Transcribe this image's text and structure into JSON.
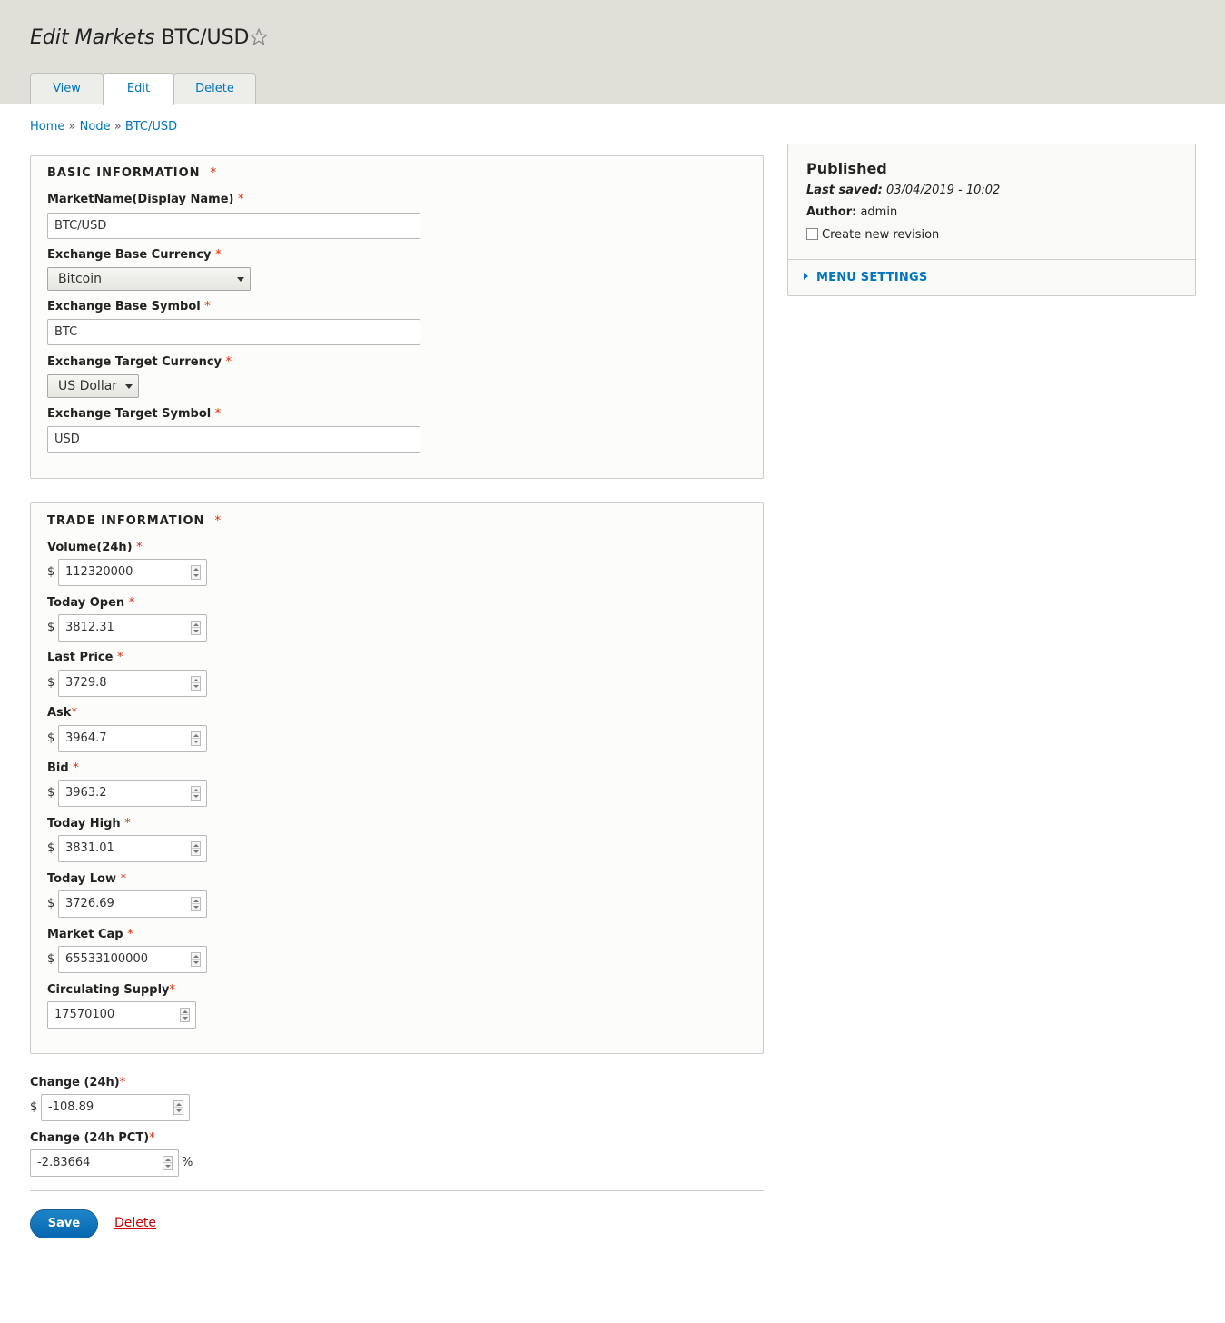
{
  "header": {
    "title_prefix": "Edit Markets",
    "title_name": "BTC/USD",
    "tabs": [
      {
        "label": "View",
        "active": false
      },
      {
        "label": "Edit",
        "active": true
      },
      {
        "label": "Delete",
        "active": false
      }
    ]
  },
  "breadcrumb": {
    "items": [
      "Home",
      "Node",
      "BTC/USD"
    ],
    "separator": "»"
  },
  "basic": {
    "legend": "BASIC INFORMATION",
    "market_name": {
      "label": "MarketName(Display Name)",
      "value": "BTC/USD"
    },
    "base_currency": {
      "label": "Exchange Base Currency",
      "value": "Bitcoin"
    },
    "base_symbol": {
      "label": "Exchange Base Symbol",
      "value": "BTC"
    },
    "target_currency": {
      "label": "Exchange Target Currency",
      "value": "US Dollar"
    },
    "target_symbol": {
      "label": "Exchange Target Symbol",
      "value": "USD"
    }
  },
  "trade": {
    "legend": "TRADE INFORMATION",
    "currency_prefix": "$",
    "fields": [
      {
        "label": "Volume(24h)",
        "value": "112320000"
      },
      {
        "label": "Today Open",
        "value": "3812.31"
      },
      {
        "label": "Last Price",
        "value": "3729.8"
      },
      {
        "label": "Ask",
        "value": "3964.7"
      },
      {
        "label": "Bid",
        "value": "3963.2"
      },
      {
        "label": "Today High",
        "value": "3831.01"
      },
      {
        "label": "Today Low",
        "value": "3726.69"
      },
      {
        "label": "Market Cap",
        "value": "65533100000"
      }
    ],
    "circulating_supply": {
      "label": "Circulating Supply",
      "value": "17570100"
    }
  },
  "change": {
    "change_24h": {
      "label": "Change (24h)",
      "prefix": "$",
      "value": "-108.89"
    },
    "change_pct": {
      "label": "Change (24h PCT)",
      "value": "-2.83664",
      "suffix": "%"
    }
  },
  "sidebar": {
    "status": "Published",
    "last_saved_label": "Last saved:",
    "last_saved_value": "03/04/2019 - 10:02",
    "author_label": "Author:",
    "author_value": "admin",
    "revision_label": "Create new revision",
    "revision_checked": false,
    "menu_settings": "MENU SETTINGS"
  },
  "actions": {
    "save": "Save",
    "delete": "Delete"
  },
  "required_mark": "*",
  "colors": {
    "header_bg": "#e0e0d8",
    "link": "#0074bd",
    "required": "#e32700",
    "save_button": "#0567b0",
    "delete_link": "#cc0000"
  }
}
